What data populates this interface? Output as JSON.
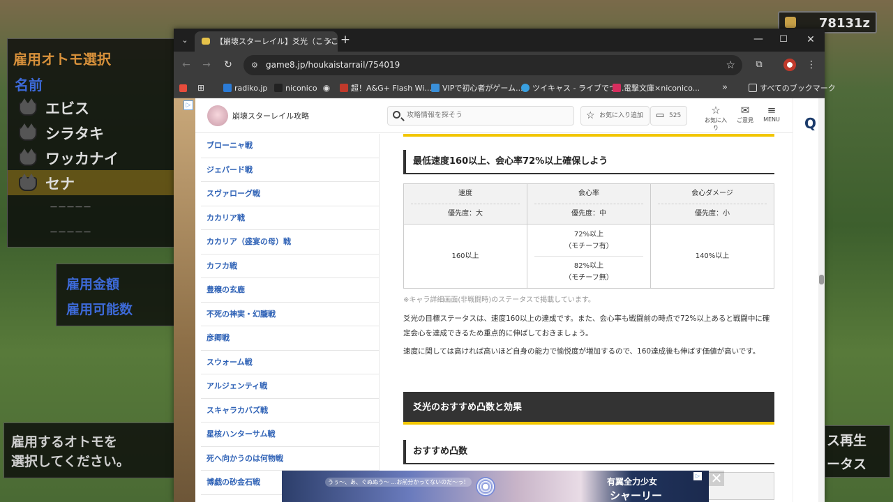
{
  "game": {
    "money": "78131z",
    "panel_title": "雇用オトモ選択",
    "name_header": "名前",
    "otomo": [
      "エビス",
      "シラタキ",
      "ワッカナイ",
      "セナ"
    ],
    "placeholder_rows": [
      "－－－－－",
      "－－－－－"
    ],
    "fee_label": "雇用金額",
    "count_label": "雇用可能数",
    "instruction_line1": "雇用するオトモを",
    "instruction_line2": "選択してください。",
    "right_label1": "ス再生",
    "right_label2": "ータス"
  },
  "browser": {
    "tab_title": "【崩壊スターレイル】爻光（こうこう）",
    "url": "game8.jp/houkaistarrail/754019",
    "bookmarks": [
      "radiko.jp",
      "niconico",
      "超！A&G+ Flash Wi...",
      "VIPで初心者がゲーム...",
      "ツイキャス - ライブでつ...",
      "電撃文庫×niconico..."
    ],
    "all_bookmarks": "すべてのブックマーク",
    "more": "»"
  },
  "site": {
    "name": "崩壊スターレイル攻略",
    "search_placeholder": "攻略情報を探そう",
    "favorite_add": "お気に入り追加",
    "comments": "525",
    "favorites": "お気に入り",
    "opinion": "ご意見",
    "menu": "MENU",
    "right_initial": "Q"
  },
  "sidebar": {
    "items": [
      "ブローニャ戦",
      "ジェパード戦",
      "スヴァローグ戦",
      "カカリア戦",
      "カカリア（盛宴の母）戦",
      "カフカ戦",
      "豊穣の玄鹿",
      "不死の神実・幻朧戦",
      "彦卿戦",
      "スウォーム戦",
      "アルジェンティ戦",
      "スキャラカバズ戦",
      "星核ハンターサム戦",
      "死へ向かうのは何物戦",
      "博戯の砂金石戦"
    ]
  },
  "content": {
    "section1_heading": "最低速度160以上、会心率72%以上確保しよう",
    "table": {
      "headers": [
        {
          "name": "速度",
          "priority": "優先度：大"
        },
        {
          "name": "会心率",
          "priority": "優先度：中"
        },
        {
          "name": "会心ダメージ",
          "priority": "優先度：小"
        }
      ],
      "speed": "160以上",
      "crit_rate_1a": "72%以上",
      "crit_rate_1b": "（モチーフ有）",
      "crit_rate_2a": "82%以上",
      "crit_rate_2b": "（モチーフ無）",
      "crit_dmg": "140%以上"
    },
    "note": "※キャラ詳細画面(非戦闘時)のステータスで掲載しています。",
    "para1": "爻光の目標ステータスは、速度160以上の達成です。また、会心率も戦闘前の時点で72%以上あると戦闘中に確定会心を達成できるため重点的に伸ばしておきましょう。",
    "para2": "速度に関しては高ければ高いほど自身の能力で愉悦度が増加するので、160達成後も伸ばす価値が高いです。",
    "section2_heading": "爻光のおすすめ凸数と効果",
    "section3_heading": "おすすめ凸数"
  },
  "ad": {
    "speech": "うぅ〜、あ、ぐぬぬう〜 …お前分かってないのだ〜っ！",
    "title": "有翼全力少女",
    "subtitle": "シャーリー"
  }
}
